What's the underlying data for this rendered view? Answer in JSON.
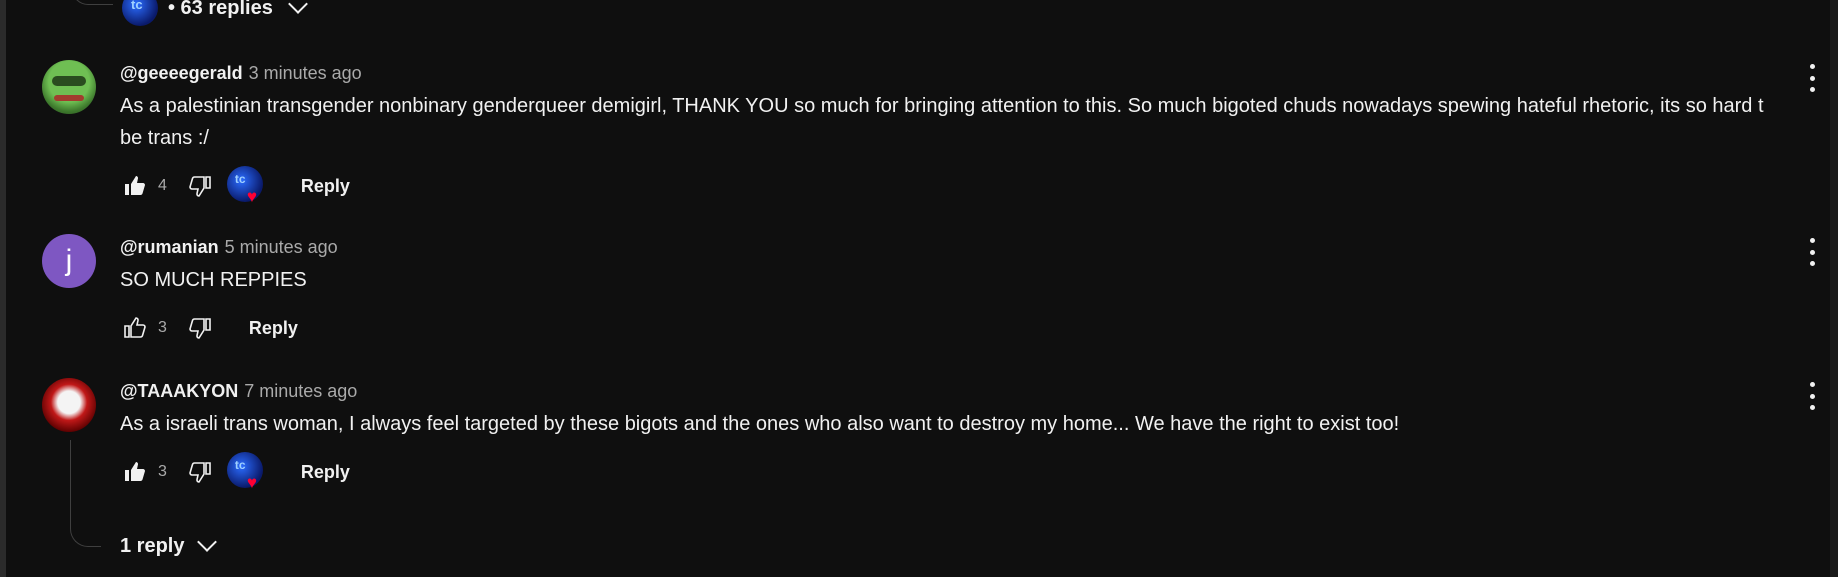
{
  "top_thread": {
    "replies_label": "• 63 replies"
  },
  "comments": [
    {
      "author": "@geeeegerald",
      "time": "3 minutes ago",
      "text_line1": "As a palestinian transgender nonbinary genderqueer demigirl, THANK YOU so much for bringing attention to this. So much bigoted chuds nowadays spewing hateful rhetoric, its so hard t",
      "text_line2": "be trans :/",
      "likes": "4",
      "reply_label": "Reply",
      "liked": true,
      "creator_heart": true
    },
    {
      "author": "@rumanian",
      "time": "5 minutes ago",
      "avatar_letter": "j",
      "text_line1": "SO MUCH REPPIES",
      "likes": "3",
      "reply_label": "Reply",
      "liked": false,
      "creator_heart": false
    },
    {
      "author": "@TAAAKYON",
      "time": "7 minutes ago",
      "text_line1": "As a israeli trans woman, I always feel targeted by these bigots and the ones who also want to destroy my home... We have the right to exist too!",
      "likes": "3",
      "reply_label": "Reply",
      "liked": true,
      "creator_heart": true
    }
  ],
  "bottom_thread": {
    "replies_label": "1 reply"
  },
  "colors": {
    "background": "#0f0f0f",
    "text": "#f1f1f1",
    "secondary": "#aaaaaa",
    "heart": "#ff0033",
    "letter_avatar": "#7e57c2"
  }
}
